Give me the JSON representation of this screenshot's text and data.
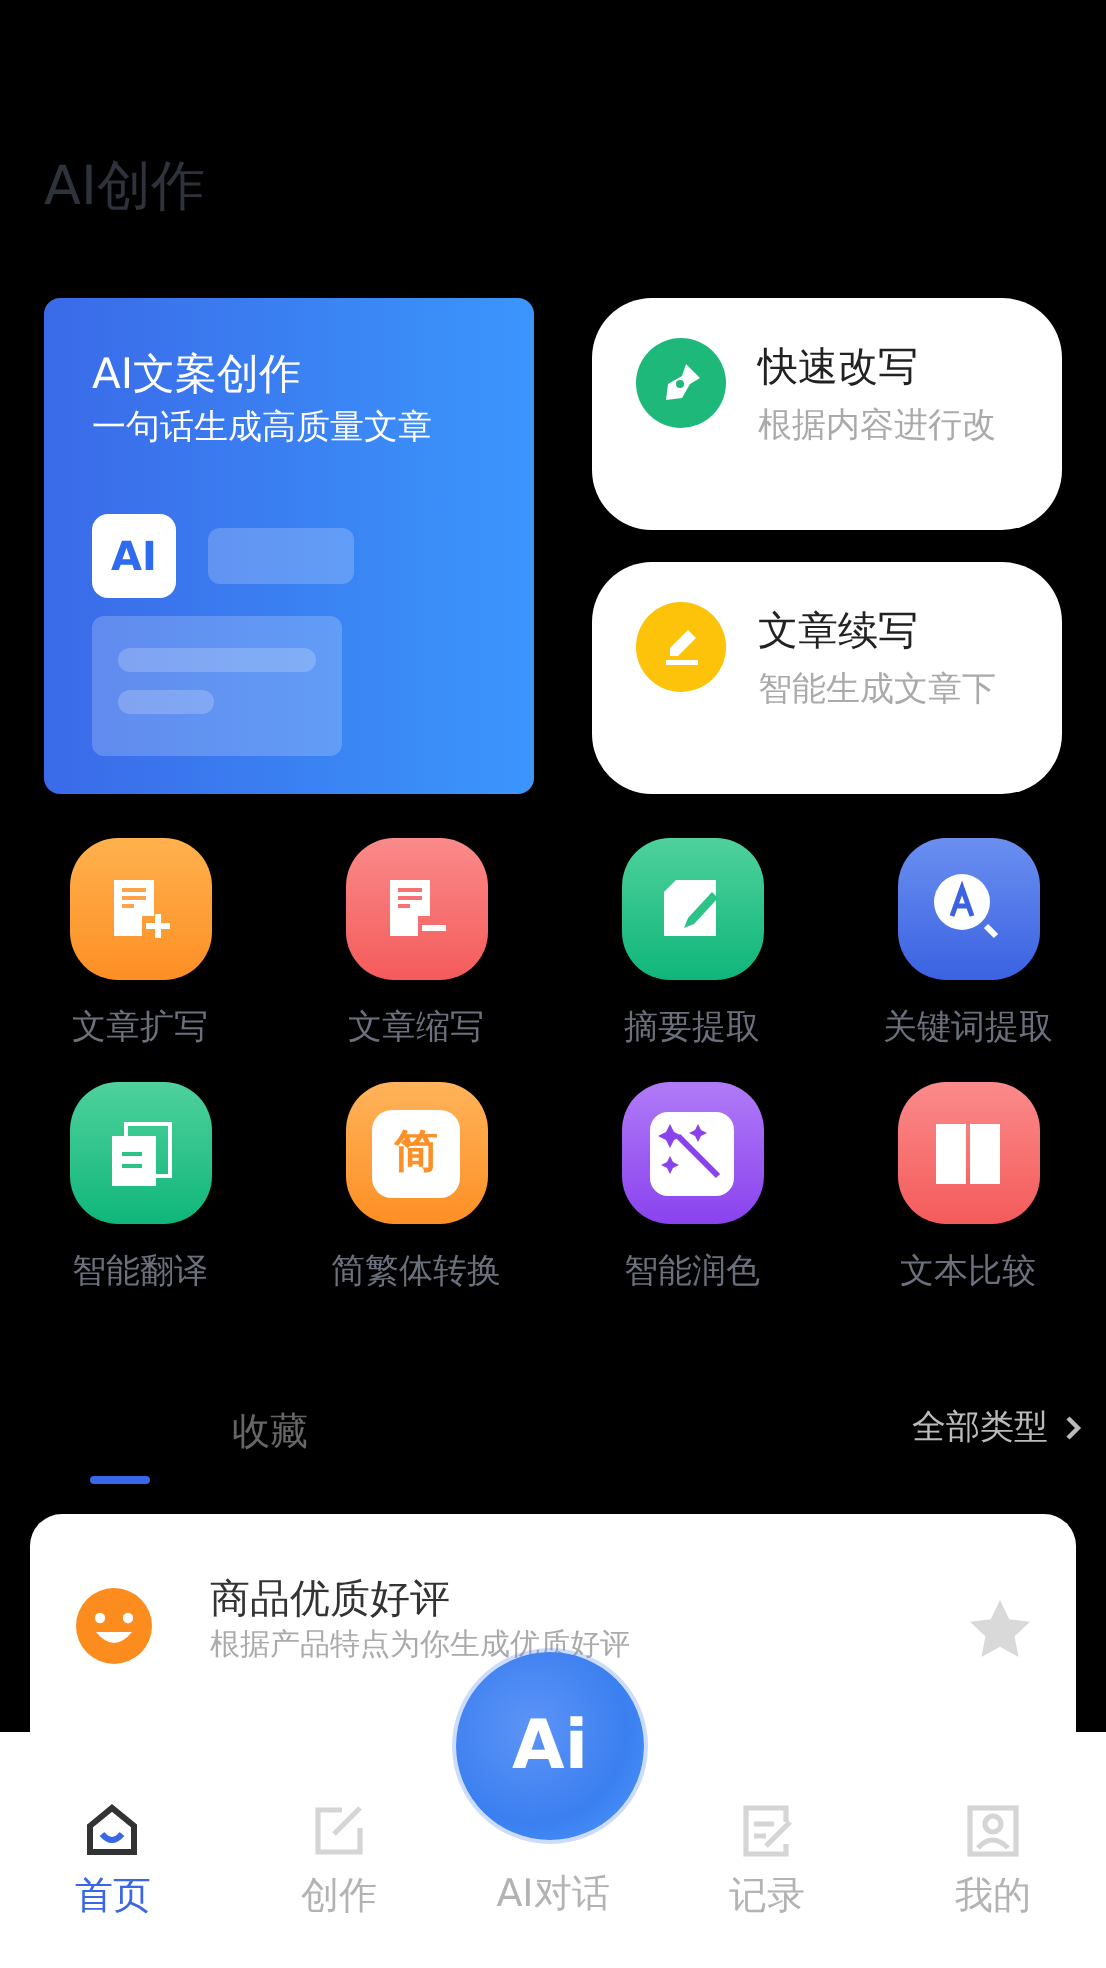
{
  "title": "AI创作",
  "hero": {
    "title": "AI文案创作",
    "subtitle": "一句话生成高质量文章",
    "badge": "AI"
  },
  "quick_cards": [
    {
      "title": "快速改写",
      "description": "根据内容进行改"
    },
    {
      "title": "文章续写",
      "description": "智能生成文章下"
    }
  ],
  "tools": [
    {
      "label": "文章扩写"
    },
    {
      "label": "文章缩写"
    },
    {
      "label": "摘要提取"
    },
    {
      "label": "关键词提取"
    },
    {
      "label": "智能翻译"
    },
    {
      "label": "简繁体转换",
      "icon_text": "简"
    },
    {
      "label": "智能润色"
    },
    {
      "label": "文本比较"
    }
  ],
  "tabs": [
    {
      "selected": true
    },
    {
      "label": "收藏",
      "selected": false
    }
  ],
  "all_types": "全部类型",
  "templates": [
    {
      "title": "商品优质好评",
      "description": "根据产品特点为你生成优质好评",
      "starred": false
    }
  ],
  "ai_button": "Ai",
  "nav": [
    {
      "label": "首页",
      "selected": true
    },
    {
      "label": "创作",
      "selected": false
    },
    {
      "label": "AI对话",
      "selected": false
    },
    {
      "label": "记录",
      "selected": false
    },
    {
      "label": "我的",
      "selected": false
    }
  ]
}
